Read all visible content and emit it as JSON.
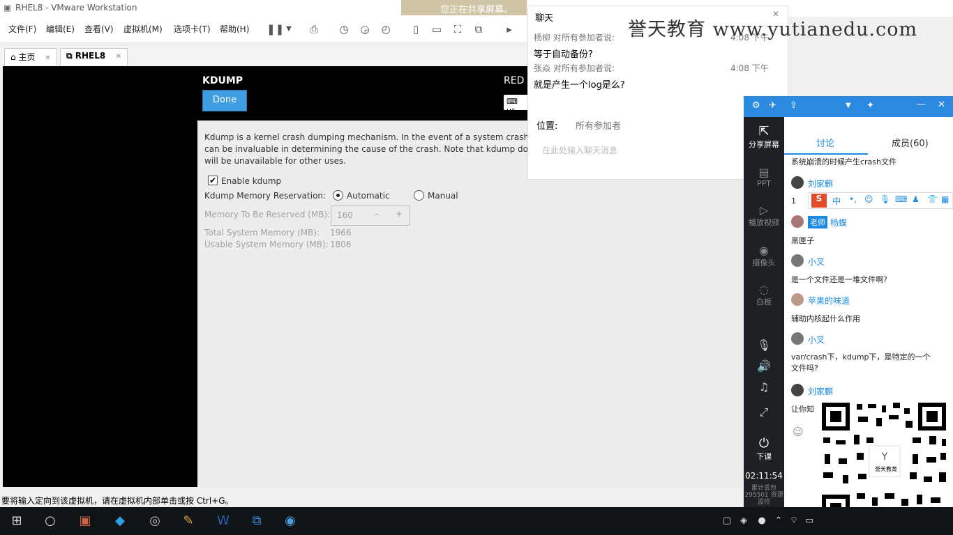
{
  "window": {
    "title": "RHEL8 - VMware Workstation",
    "menu": [
      "文件(F)",
      "编辑(E)",
      "查看(V)",
      "虚拟机(M)",
      "选项卡(T)",
      "帮助(H)"
    ],
    "tabs": [
      "主页",
      "RHEL8"
    ],
    "status_text": "要将输入定向到该虚拟机，请在虚拟机内部单击或按 Ctrl+G。"
  },
  "share_banner": "您正在共享屏幕。",
  "kdump": {
    "title": "KDUMP",
    "done_label": "Done",
    "distro_label": "RED",
    "kbd_label": "us",
    "desc_line1": "Kdump is a kernel crash dumping mechanism. In the event of a system crash, kd",
    "desc_line2": "can be invaluable in determining the cause of the crash. Note that kdump does r",
    "desc_line3": "will be unavailable for other uses.",
    "enable_label": "Enable kdump",
    "enable_checked": true,
    "reservation_label": "Kdump Memory Reservation:",
    "option_automatic": "Automatic",
    "option_manual": "Manual",
    "selected_option": "Automatic",
    "memory_reserved_label": "Memory To Be Reserved (MB):",
    "memory_reserved_value": "160",
    "total_memory_label": "Total System Memory (MB):",
    "total_memory_value": "1966",
    "usable_memory_label": "Usable System Memory (MB):",
    "usable_memory_value": "1806"
  },
  "chat": {
    "title": "聊天",
    "messages": [
      {
        "sender": "杨柳 对所有参加者说:",
        "time": "4:08 下午",
        "text": "等于自动备份?"
      },
      {
        "sender": "张焱 对所有参加者说:",
        "time": "4:08 下午",
        "text": "就是产生一个log是么?"
      }
    ],
    "position_label": "位置:",
    "position_value": "所有参加者",
    "input_placeholder": "在此处输入聊天消息"
  },
  "watermark": "誉天教育 www.yutianedu.com",
  "classroom": {
    "tabs": [
      "讨论",
      "成员(60)"
    ],
    "left_items": [
      "分享屏幕",
      "PPT",
      "播放视频",
      "摄像头",
      "白板",
      "下课"
    ],
    "timer": "02:11:54",
    "stats": "累计丢包 295501 资源监控",
    "messages": [
      {
        "name": "",
        "text": "系统崩溃的时候产生crash文件"
      },
      {
        "name": "刘家麒",
        "text": "1"
      },
      {
        "name": "杨蝶",
        "badge": "老师",
        "text": "黑匣子"
      },
      {
        "name": "小叉",
        "text": "是一个文件还是一堆文件啊?"
      },
      {
        "name": "苹果的味道",
        "text": "辅助内核起什么作用"
      },
      {
        "name": "小叉",
        "text": "var/crash下，kdump下，是特定的一个文件吗?"
      },
      {
        "name": "刘家麒",
        "text": "让你知"
      }
    ],
    "ime_label": "中",
    "qr_caption": "誉天教育"
  },
  "colors": {
    "accent": "#2b8ae0",
    "done_button": "#3f9ee2",
    "taskbar": "#0f1418"
  }
}
